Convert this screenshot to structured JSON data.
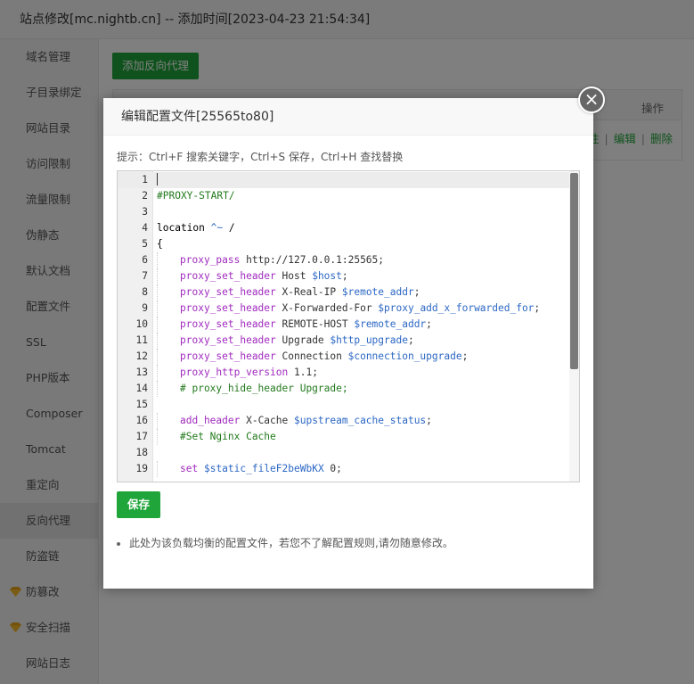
{
  "window": {
    "title": "站点修改[mc.nightb.cn] -- 添加时间[2023-04-23 21:54:34]"
  },
  "sidebar": {
    "items": [
      {
        "label": "域名管理",
        "icon": ""
      },
      {
        "label": "子目录绑定",
        "icon": ""
      },
      {
        "label": "网站目录",
        "icon": ""
      },
      {
        "label": "访问限制",
        "icon": ""
      },
      {
        "label": "流量限制",
        "icon": ""
      },
      {
        "label": "伪静态",
        "icon": ""
      },
      {
        "label": "默认文档",
        "icon": ""
      },
      {
        "label": "配置文件",
        "icon": ""
      },
      {
        "label": "SSL",
        "icon": ""
      },
      {
        "label": "PHP版本",
        "icon": ""
      },
      {
        "label": "Composer",
        "icon": ""
      },
      {
        "label": "Tomcat",
        "icon": ""
      },
      {
        "label": "重定向",
        "icon": ""
      },
      {
        "label": "反向代理",
        "icon": "",
        "active": true
      },
      {
        "label": "防盗链",
        "icon": ""
      },
      {
        "label": "防篡改",
        "icon": "gem-icon"
      },
      {
        "label": "安全扫描",
        "icon": "gem-icon"
      },
      {
        "label": "网站日志",
        "icon": ""
      }
    ]
  },
  "content": {
    "add_button": "添加反向代理",
    "table_header_op": "操作",
    "row_links": {
      "partial": "性",
      "edit": "编辑",
      "delete": "删除"
    }
  },
  "modal": {
    "title": "编辑配置文件[25565to80]",
    "close_icon": "close-icon",
    "tip": "提示：Ctrl+F 搜索关键字，Ctrl+S 保存，Ctrl+H 查找替换",
    "save_button": "保存",
    "note": "此处为该负载均衡的配置文件，若您不了解配置规则,请勿随意修改。"
  },
  "editor": {
    "lines": [
      {
        "n": "1",
        "indent": 0,
        "parts": []
      },
      {
        "n": "2",
        "indent": 0,
        "parts": [
          {
            "t": "#PROXY-START/",
            "c": "comment"
          }
        ]
      },
      {
        "n": "3",
        "indent": 0,
        "parts": []
      },
      {
        "n": "4",
        "indent": 0,
        "parts": [
          {
            "t": "location ",
            "c": "kw"
          },
          {
            "t": "^~",
            "c": "var"
          },
          {
            "t": " /",
            "c": "kw"
          }
        ]
      },
      {
        "n": "5",
        "indent": 0,
        "parts": [
          {
            "t": "{",
            "c": "kw"
          }
        ]
      },
      {
        "n": "6",
        "indent": 1,
        "parts": [
          {
            "t": "proxy_pass",
            "c": "dir"
          },
          {
            "t": " http://127.0.0.1:25565;",
            "c": "str"
          }
        ]
      },
      {
        "n": "7",
        "indent": 1,
        "parts": [
          {
            "t": "proxy_set_header",
            "c": "dir"
          },
          {
            "t": " Host ",
            "c": "str"
          },
          {
            "t": "$host",
            "c": "var"
          },
          {
            "t": ";",
            "c": "str"
          }
        ]
      },
      {
        "n": "8",
        "indent": 1,
        "parts": [
          {
            "t": "proxy_set_header",
            "c": "dir"
          },
          {
            "t": " X-Real-IP ",
            "c": "str"
          },
          {
            "t": "$remote_addr",
            "c": "var"
          },
          {
            "t": ";",
            "c": "str"
          }
        ]
      },
      {
        "n": "9",
        "indent": 1,
        "parts": [
          {
            "t": "proxy_set_header",
            "c": "dir"
          },
          {
            "t": " X-Forwarded-For ",
            "c": "str"
          },
          {
            "t": "$proxy_add_x_forwarded_for",
            "c": "var"
          },
          {
            "t": ";",
            "c": "str"
          }
        ]
      },
      {
        "n": "10",
        "indent": 1,
        "parts": [
          {
            "t": "proxy_set_header",
            "c": "dir"
          },
          {
            "t": " REMOTE-HOST ",
            "c": "str"
          },
          {
            "t": "$remote_addr",
            "c": "var"
          },
          {
            "t": ";",
            "c": "str"
          }
        ]
      },
      {
        "n": "11",
        "indent": 1,
        "parts": [
          {
            "t": "proxy_set_header",
            "c": "dir"
          },
          {
            "t": " Upgrade ",
            "c": "str"
          },
          {
            "t": "$http_upgrade",
            "c": "var"
          },
          {
            "t": ";",
            "c": "str"
          }
        ]
      },
      {
        "n": "12",
        "indent": 1,
        "parts": [
          {
            "t": "proxy_set_header",
            "c": "dir"
          },
          {
            "t": " Connection ",
            "c": "str"
          },
          {
            "t": "$connection_upgrade",
            "c": "var"
          },
          {
            "t": ";",
            "c": "str"
          }
        ]
      },
      {
        "n": "13",
        "indent": 1,
        "parts": [
          {
            "t": "proxy_http_version",
            "c": "dir"
          },
          {
            "t": " 1.1;",
            "c": "str"
          }
        ]
      },
      {
        "n": "14",
        "indent": 1,
        "parts": [
          {
            "t": "# proxy_hide_header Upgrade;",
            "c": "comment"
          }
        ]
      },
      {
        "n": "15",
        "indent": 0,
        "parts": []
      },
      {
        "n": "16",
        "indent": 1,
        "parts": [
          {
            "t": "add_header",
            "c": "dir"
          },
          {
            "t": " X-Cache ",
            "c": "str"
          },
          {
            "t": "$upstream_cache_status",
            "c": "var"
          },
          {
            "t": ";",
            "c": "str"
          }
        ]
      },
      {
        "n": "17",
        "indent": 1,
        "parts": [
          {
            "t": "#Set Nginx Cache",
            "c": "comment"
          }
        ]
      },
      {
        "n": "18",
        "indent": 0,
        "parts": []
      },
      {
        "n": "19",
        "indent": 1,
        "parts": [
          {
            "t": "set",
            "c": "dir"
          },
          {
            "t": " ",
            "c": "str"
          },
          {
            "t": "$static_fileF2beWbKX",
            "c": "var"
          },
          {
            "t": " 0;",
            "c": "str"
          }
        ]
      }
    ]
  },
  "colors": {
    "accent": "#20a53a",
    "overlay": "rgba(0,0,0,0.5)"
  }
}
